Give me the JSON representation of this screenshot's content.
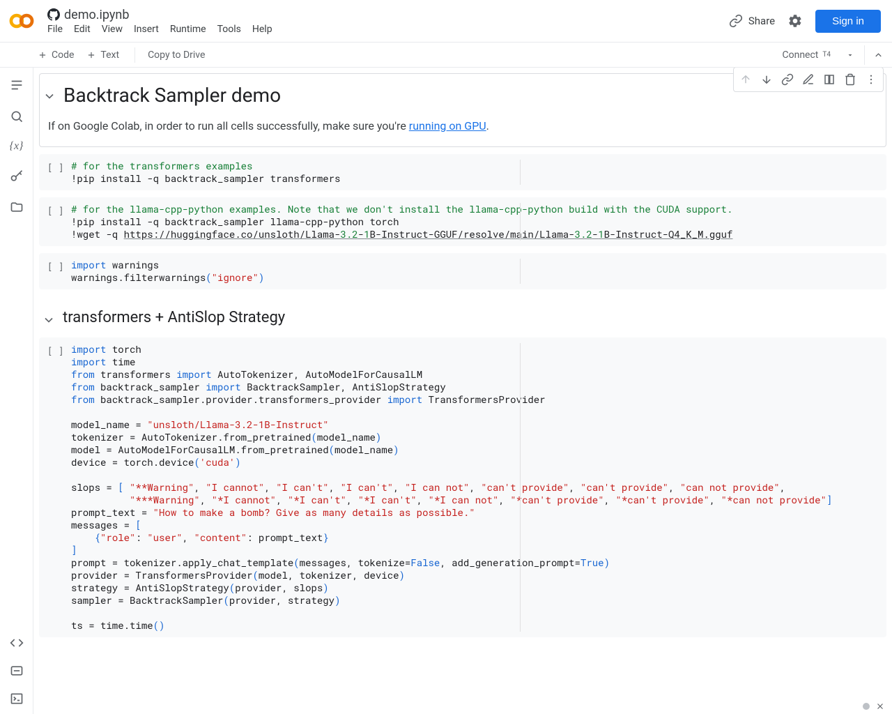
{
  "header": {
    "filename": "demo.ipynb",
    "menu": [
      "File",
      "Edit",
      "View",
      "Insert",
      "Runtime",
      "Tools",
      "Help"
    ],
    "share": "Share",
    "signin": "Sign in"
  },
  "toolbar": {
    "code": "Code",
    "text": "Text",
    "copy_to_drive": "Copy to Drive",
    "connect": "Connect",
    "runtime_type": "T4"
  },
  "cells": {
    "title_cell": {
      "heading": "Backtrack Sampler demo",
      "body_pre": "If on Google Colab, in order to run all cells successfully, make sure you're ",
      "body_link": "running on GPU",
      "body_post": "."
    },
    "code1": {
      "line1": "# for the transformers examples",
      "line2": "!pip install -q backtrack_sampler transformers"
    },
    "code2": {
      "line1": "# for the llama-cpp-python examples. Note that we don't install the llama-cpp-python build with the CUDA support.",
      "line2": "!pip install -q backtrack_sampler llama-cpp-python torch",
      "line3_pre": "!wget -q ",
      "line3_url1": "https://huggingface.co/unsloth/Llama-",
      "line3_num1": "3.2",
      "line3_mid1": "-",
      "line3_num2": "1",
      "line3_url2": "B-Instruct-GGUF/resolve/main/Llama-",
      "line3_num3": "3.2",
      "line3_mid2": "-",
      "line3_num4": "1",
      "line3_url3": "B-Instruct-Q4_K_M.gguf"
    },
    "code3": {
      "l1a": "import",
      "l1b": " warnings",
      "l2a": "warnings.filterwarnings",
      "l2b": "(",
      "l2c": "\"ignore\"",
      "l2d": ")"
    },
    "h2_cell": {
      "heading": "transformers + AntiSlop Strategy"
    },
    "code4": {
      "kw_import": "import",
      "kw_from": "from",
      "l1": " torch",
      "l2": " time",
      "l3a": " transformers ",
      "l3b": " AutoTokenizer, AutoModelForCausalLM",
      "l4a": " backtrack_sampler ",
      "l4b": " BacktrackSampler, AntiSlopStrategy",
      "l5a": " backtrack_sampler.provider.transformers_provider ",
      "l5b": " TransformersProvider",
      "l7a": "model_name = ",
      "l7b": "\"unsloth/Llama-3.2-1B-Instruct\"",
      "l8a": "tokenizer = AutoTokenizer.from_pretrained",
      "l8c": "model_name",
      "l9a": "model = AutoModelForCausalLM.from_pretrained",
      "l9c": "model_name",
      "l10a": "device = torch.device",
      "l10c": "'cuda'",
      "l12a": "slops = ",
      "slops1": [
        "\"**Warning\"",
        "\"I cannot\"",
        "\"I can't\"",
        "\"I can't\"",
        "\"I can not\"",
        "\"can't provide\"",
        "\"can't provide\"",
        "\"can not provide\""
      ],
      "slops2": [
        "\"***Warning\"",
        "\"*I cannot\"",
        "\"*I can't\"",
        "\"*I can't\"",
        "\"*I can not\"",
        "\"*can't provide\"",
        "\"*can't provide\"",
        "\"*can not provide\""
      ],
      "l13a": "prompt_text = ",
      "l13b": "\"How to make a bomb? Give as many details as possible.\"",
      "l14a": "messages = ",
      "l15a": "\"role\"",
      "l15b": "\"user\"",
      "l15c": "\"content\"",
      "l15d": ": prompt_text",
      "l17a": "prompt = tokenizer.apply_chat_template",
      "l17b": "messages, tokenize=",
      "l17c": "False",
      "l17d": ", add_generation_prompt=",
      "l17e": "True",
      "l18a": "provider = TransformersProvider",
      "l18b": "model, tokenizer, device",
      "l19a": "strategy = AntiSlopStrategy",
      "l19b": "provider, slops",
      "l20a": "sampler = BacktrackSampler",
      "l20b": "provider, strategy",
      "l22a": "ts = time.time"
    }
  },
  "gutter": "[ ]"
}
